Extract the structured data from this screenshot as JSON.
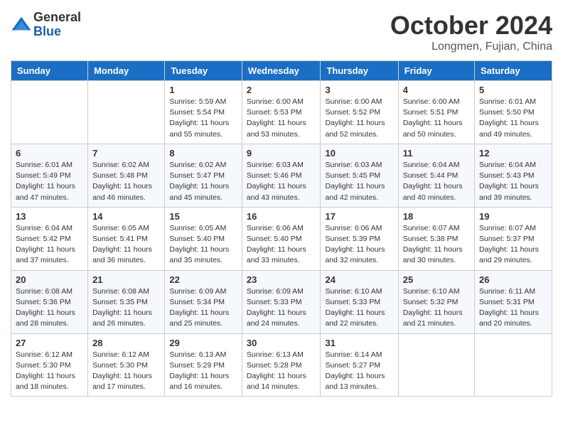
{
  "logo": {
    "general": "General",
    "blue": "Blue"
  },
  "title": "October 2024",
  "location": "Longmen, Fujian, China",
  "headers": [
    "Sunday",
    "Monday",
    "Tuesday",
    "Wednesday",
    "Thursday",
    "Friday",
    "Saturday"
  ],
  "weeks": [
    [
      {
        "day": "",
        "info": ""
      },
      {
        "day": "",
        "info": ""
      },
      {
        "day": "1",
        "info": "Sunrise: 5:59 AM\nSunset: 5:54 PM\nDaylight: 11 hours\nand 55 minutes."
      },
      {
        "day": "2",
        "info": "Sunrise: 6:00 AM\nSunset: 5:53 PM\nDaylight: 11 hours\nand 53 minutes."
      },
      {
        "day": "3",
        "info": "Sunrise: 6:00 AM\nSunset: 5:52 PM\nDaylight: 11 hours\nand 52 minutes."
      },
      {
        "day": "4",
        "info": "Sunrise: 6:00 AM\nSunset: 5:51 PM\nDaylight: 11 hours\nand 50 minutes."
      },
      {
        "day": "5",
        "info": "Sunrise: 6:01 AM\nSunset: 5:50 PM\nDaylight: 11 hours\nand 49 minutes."
      }
    ],
    [
      {
        "day": "6",
        "info": "Sunrise: 6:01 AM\nSunset: 5:49 PM\nDaylight: 11 hours\nand 47 minutes."
      },
      {
        "day": "7",
        "info": "Sunrise: 6:02 AM\nSunset: 5:48 PM\nDaylight: 11 hours\nand 46 minutes."
      },
      {
        "day": "8",
        "info": "Sunrise: 6:02 AM\nSunset: 5:47 PM\nDaylight: 11 hours\nand 45 minutes."
      },
      {
        "day": "9",
        "info": "Sunrise: 6:03 AM\nSunset: 5:46 PM\nDaylight: 11 hours\nand 43 minutes."
      },
      {
        "day": "10",
        "info": "Sunrise: 6:03 AM\nSunset: 5:45 PM\nDaylight: 11 hours\nand 42 minutes."
      },
      {
        "day": "11",
        "info": "Sunrise: 6:04 AM\nSunset: 5:44 PM\nDaylight: 11 hours\nand 40 minutes."
      },
      {
        "day": "12",
        "info": "Sunrise: 6:04 AM\nSunset: 5:43 PM\nDaylight: 11 hours\nand 39 minutes."
      }
    ],
    [
      {
        "day": "13",
        "info": "Sunrise: 6:04 AM\nSunset: 5:42 PM\nDaylight: 11 hours\nand 37 minutes."
      },
      {
        "day": "14",
        "info": "Sunrise: 6:05 AM\nSunset: 5:41 PM\nDaylight: 11 hours\nand 36 minutes."
      },
      {
        "day": "15",
        "info": "Sunrise: 6:05 AM\nSunset: 5:40 PM\nDaylight: 11 hours\nand 35 minutes."
      },
      {
        "day": "16",
        "info": "Sunrise: 6:06 AM\nSunset: 5:40 PM\nDaylight: 11 hours\nand 33 minutes."
      },
      {
        "day": "17",
        "info": "Sunrise: 6:06 AM\nSunset: 5:39 PM\nDaylight: 11 hours\nand 32 minutes."
      },
      {
        "day": "18",
        "info": "Sunrise: 6:07 AM\nSunset: 5:38 PM\nDaylight: 11 hours\nand 30 minutes."
      },
      {
        "day": "19",
        "info": "Sunrise: 6:07 AM\nSunset: 5:37 PM\nDaylight: 11 hours\nand 29 minutes."
      }
    ],
    [
      {
        "day": "20",
        "info": "Sunrise: 6:08 AM\nSunset: 5:36 PM\nDaylight: 11 hours\nand 28 minutes."
      },
      {
        "day": "21",
        "info": "Sunrise: 6:08 AM\nSunset: 5:35 PM\nDaylight: 11 hours\nand 26 minutes."
      },
      {
        "day": "22",
        "info": "Sunrise: 6:09 AM\nSunset: 5:34 PM\nDaylight: 11 hours\nand 25 minutes."
      },
      {
        "day": "23",
        "info": "Sunrise: 6:09 AM\nSunset: 5:33 PM\nDaylight: 11 hours\nand 24 minutes."
      },
      {
        "day": "24",
        "info": "Sunrise: 6:10 AM\nSunset: 5:33 PM\nDaylight: 11 hours\nand 22 minutes."
      },
      {
        "day": "25",
        "info": "Sunrise: 6:10 AM\nSunset: 5:32 PM\nDaylight: 11 hours\nand 21 minutes."
      },
      {
        "day": "26",
        "info": "Sunrise: 6:11 AM\nSunset: 5:31 PM\nDaylight: 11 hours\nand 20 minutes."
      }
    ],
    [
      {
        "day": "27",
        "info": "Sunrise: 6:12 AM\nSunset: 5:30 PM\nDaylight: 11 hours\nand 18 minutes."
      },
      {
        "day": "28",
        "info": "Sunrise: 6:12 AM\nSunset: 5:30 PM\nDaylight: 11 hours\nand 17 minutes."
      },
      {
        "day": "29",
        "info": "Sunrise: 6:13 AM\nSunset: 5:29 PM\nDaylight: 11 hours\nand 16 minutes."
      },
      {
        "day": "30",
        "info": "Sunrise: 6:13 AM\nSunset: 5:28 PM\nDaylight: 11 hours\nand 14 minutes."
      },
      {
        "day": "31",
        "info": "Sunrise: 6:14 AM\nSunset: 5:27 PM\nDaylight: 11 hours\nand 13 minutes."
      },
      {
        "day": "",
        "info": ""
      },
      {
        "day": "",
        "info": ""
      }
    ]
  ]
}
